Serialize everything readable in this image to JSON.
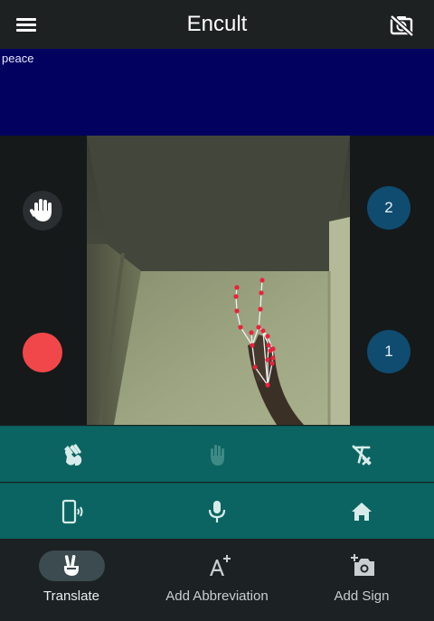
{
  "app": {
    "title": "Encult",
    "menu_icon": "menu-icon",
    "camera_off_icon": "camera-off-icon"
  },
  "result": {
    "text": "peace",
    "background": "#02015f"
  },
  "side_controls": {
    "hand_icon": "hand-icon",
    "record_color": "#f2474a",
    "buttons": [
      {
        "label": "2"
      },
      {
        "label": "1"
      }
    ]
  },
  "toolbar": {
    "row1": [
      "clap-hands-icon",
      "hand-disabled-icon",
      "clear-format-icon"
    ],
    "row2": [
      "phone-vibrate-icon",
      "mic-icon",
      "home-icon"
    ],
    "background": "#0b6461"
  },
  "bottom_nav": {
    "items": [
      {
        "label": "Translate",
        "icon": "victory-hand-icon",
        "active": true
      },
      {
        "label": "Add Abbreviation",
        "icon": "text-plus-icon",
        "active": false
      },
      {
        "label": "Add Sign",
        "icon": "add-photo-icon",
        "active": false
      }
    ]
  }
}
